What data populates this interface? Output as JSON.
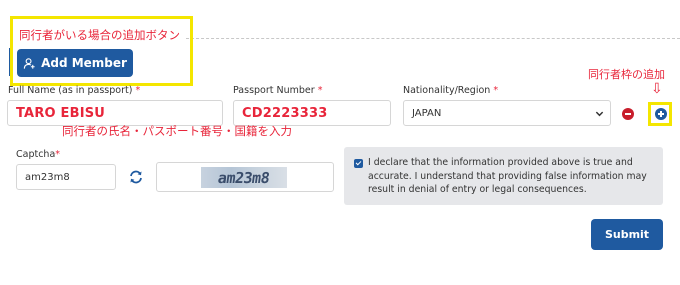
{
  "annotations": {
    "add_button_note": "同行者がいる場合の追加ボタン",
    "add_frame_note": "同行者枠の追加",
    "add_frame_arrow": "⇩",
    "fields_note": "同行者の氏名・パスポート番号・国籍を入力"
  },
  "member": {
    "add_button_label": "Add Member",
    "full_name": {
      "label": "Full Name (as in passport)",
      "required_mark": "*",
      "value": "TARO EBISU"
    },
    "passport_number": {
      "label": "Passport Number",
      "required_mark": "*",
      "value": "CD2223333"
    },
    "nationality": {
      "label": "Nationality/Region",
      "required_mark": "*",
      "value": "JAPAN"
    }
  },
  "captcha": {
    "label": "Captcha",
    "required_mark": "*",
    "input_value": "am23m8",
    "image_text": "am23m8",
    "refresh_icon": "refresh-icon"
  },
  "declaration": {
    "checked": true,
    "text": "I declare that the information provided above is true and accurate. I understand that providing false information may result in denial of entry or legal consequences."
  },
  "actions": {
    "submit_label": "Submit"
  },
  "colors": {
    "primary": "#1f5aa0",
    "danger": "#c81e2c",
    "annotation": "#e8253a",
    "highlight": "#f4e600"
  }
}
